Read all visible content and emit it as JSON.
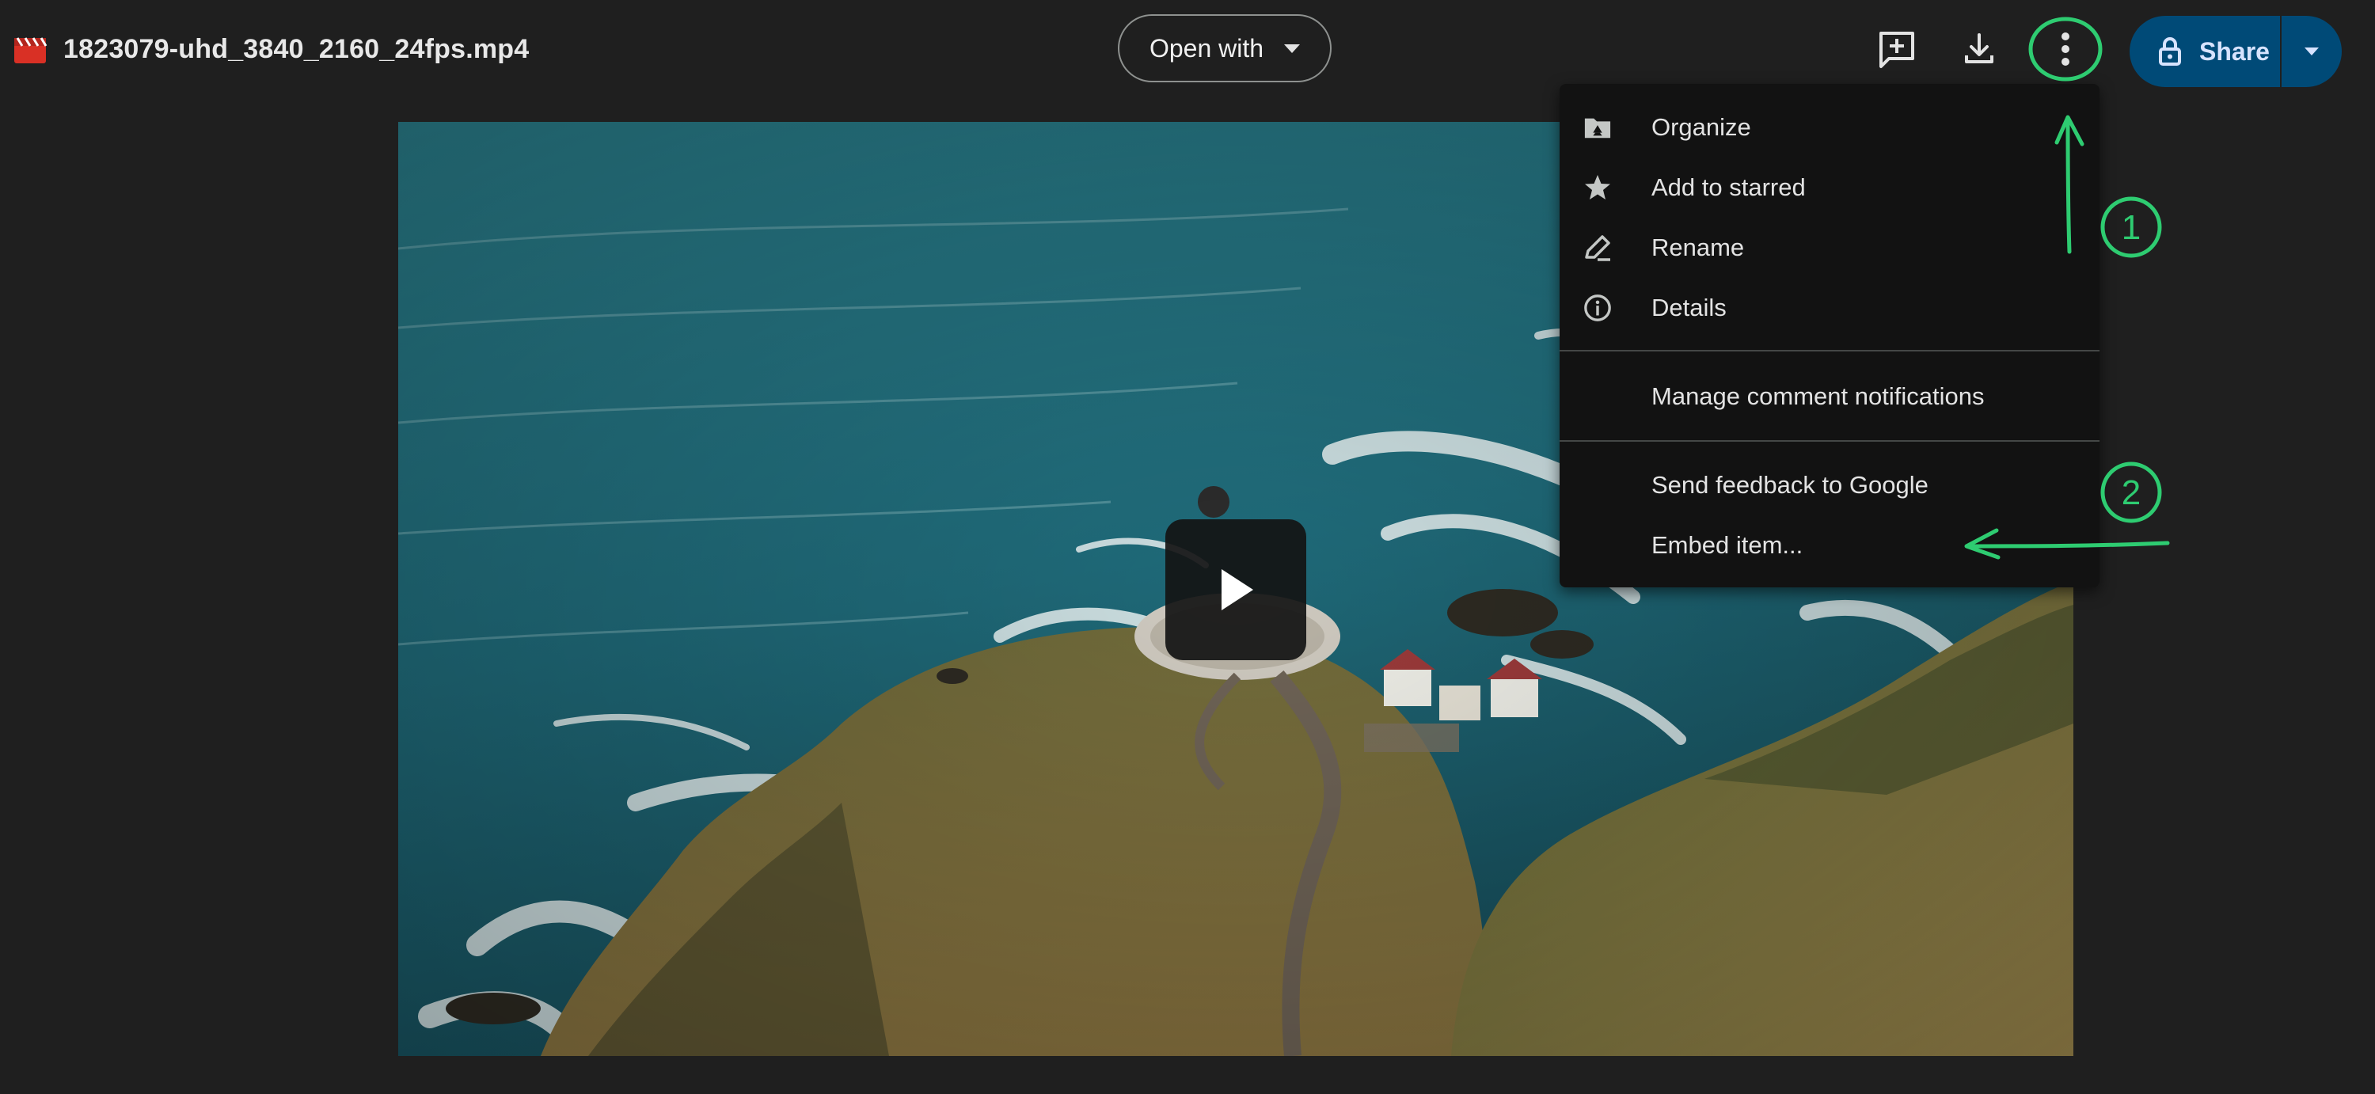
{
  "header": {
    "file_name": "1823079-uhd_3840_2160_24fps.mp4",
    "open_with_label": "Open with",
    "share_label": "Share"
  },
  "icons": {
    "file_type": "video-file-icon",
    "add_comment": "add-comment-icon",
    "download": "download-icon",
    "more_actions": "more-vert-icon",
    "share_lock": "lock-icon",
    "play": "play-icon"
  },
  "menu": {
    "items": [
      {
        "label": "Organize",
        "icon": "folder-drive-icon"
      },
      {
        "label": "Add to starred",
        "icon": "star-icon"
      },
      {
        "label": "Rename",
        "icon": "pencil-icon"
      },
      {
        "label": "Details",
        "icon": "info-icon"
      },
      {
        "label": "Manage comment notifications",
        "icon": ""
      },
      {
        "label": "Send feedback to Google",
        "icon": ""
      },
      {
        "label": "Embed item...",
        "icon": ""
      }
    ]
  },
  "annotations": {
    "step_1": "1",
    "step_2": "2",
    "color": "#2ecc71"
  },
  "colors": {
    "background": "#1f1f1f",
    "menu_background": "#121212",
    "share_button": "#004a77",
    "share_text": "#d7e3ff",
    "file_icon_red": "#d93025"
  }
}
